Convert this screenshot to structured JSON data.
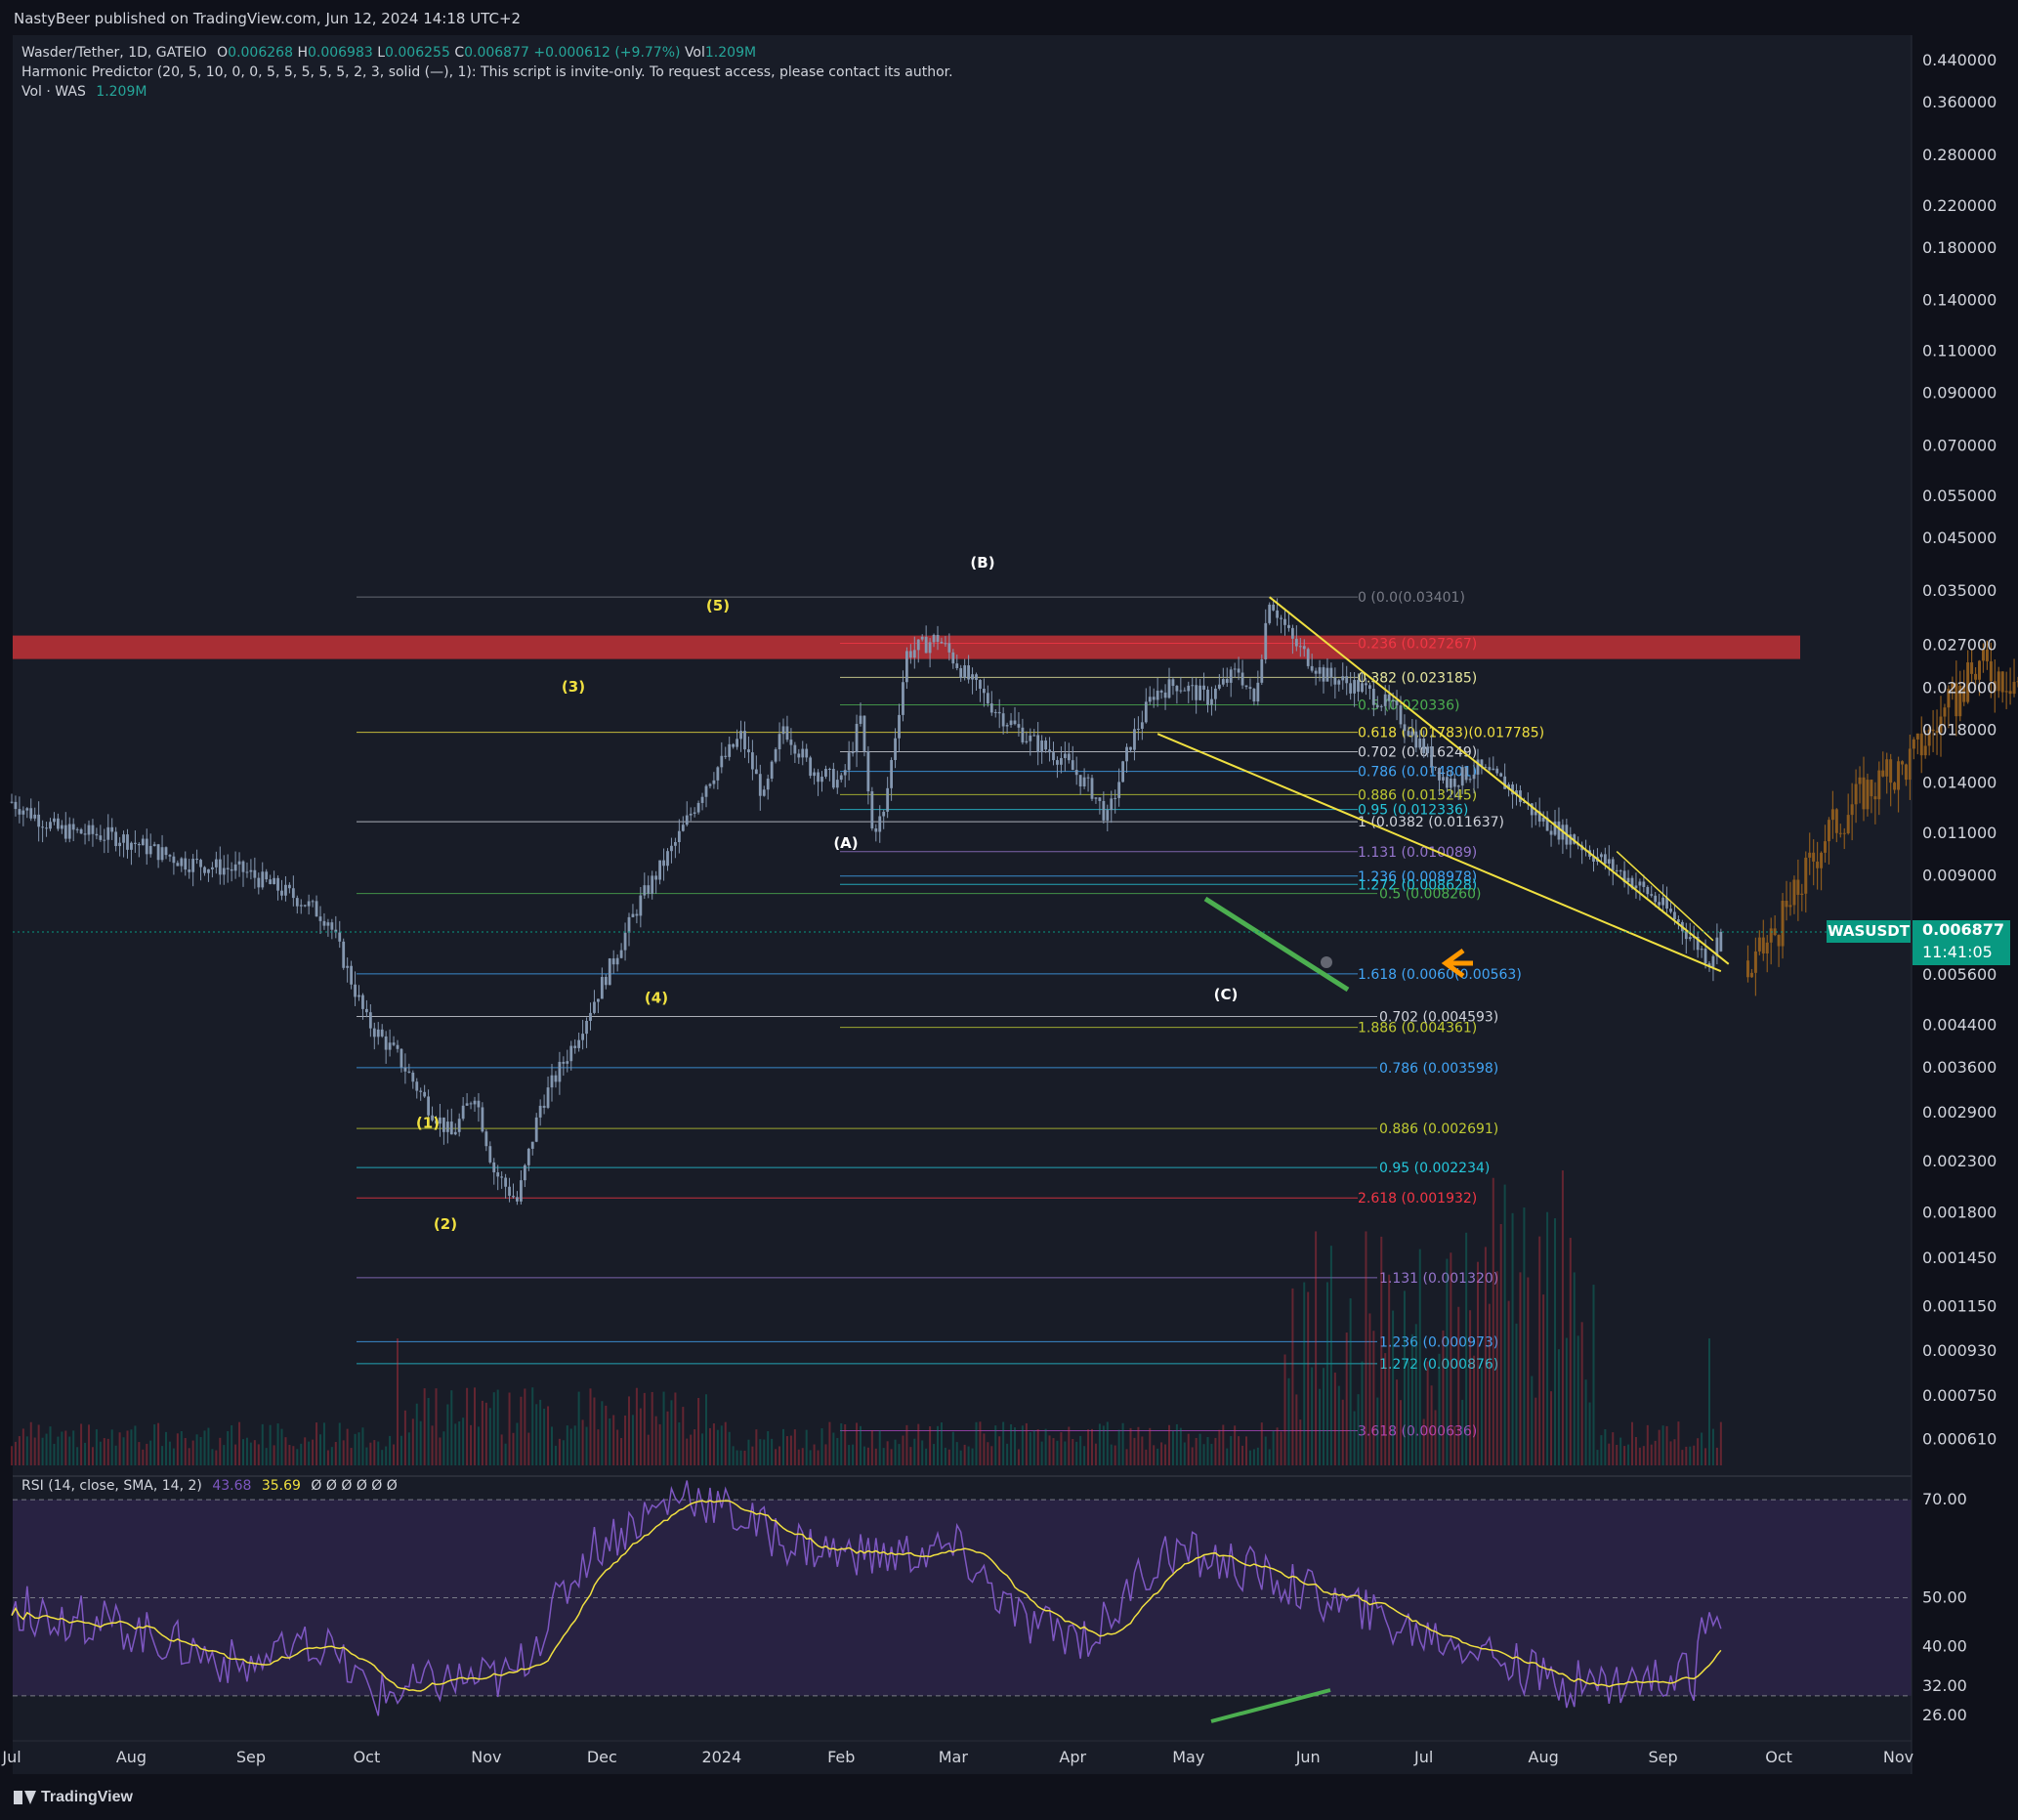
{
  "header": {
    "published": "NastyBeer published on TradingView.com, Jun 12, 2024 14:18 UTC+2"
  },
  "legend": {
    "symbol": "Wasder/Tether, 1D, GATEIO",
    "o_label": "O",
    "o": "0.006268",
    "h_label": "H",
    "h": "0.006983",
    "l_label": "L",
    "l": "0.006255",
    "c_label": "C",
    "c": "0.006877",
    "change": "+0.000612 (+9.77%)",
    "vol_label": "Vol",
    "vol": "1.209M",
    "indicator": "Harmonic Predictor (20, 5, 10, 0, 0, 5, 5, 5, 5, 5, 2, 3, solid (—), 1): This script is invite-only. To request access, please contact its author.",
    "vol_line_label": "Vol · WAS",
    "vol_line_value": "1.209M"
  },
  "rsi_legend": {
    "label": "RSI (14, close, SMA, 14, 2)",
    "rsi": "43.68",
    "sma": "35.69",
    "extra": "Ø Ø Ø Ø Ø Ø"
  },
  "symbol_tag": "WASUSDT",
  "price_tag": {
    "price": "0.006877",
    "countdown": "11:41:05"
  },
  "footer": {
    "brand": "TradingView"
  },
  "colors": {
    "up": "#089981",
    "down": "#f23645",
    "bg": "#181c27",
    "candle": "#8497b0",
    "projection": "#8b5a1e",
    "resistance": "#d9343a",
    "wedge": "#f0e040",
    "green": "#4caf50",
    "rsi": "#7e57c2",
    "arrow": "#ff9800"
  },
  "chart_data": {
    "type": "candlestick",
    "log_scale": true,
    "price_axis_labels": [
      "0.440000",
      "0.360000",
      "0.280000",
      "0.220000",
      "0.180000",
      "0.140000",
      "0.110000",
      "0.090000",
      "0.070000",
      "0.055000",
      "0.045000",
      "0.035000",
      "0.027000",
      "0.022000",
      "0.018000",
      "0.014000",
      "0.011000",
      "0.009000",
      "0.005600",
      "0.004400",
      "0.003600",
      "0.002900",
      "0.002300",
      "0.001800",
      "0.001450",
      "0.001150",
      "0.000930",
      "0.000750",
      "0.000610"
    ],
    "time_axis_labels": [
      "Jul",
      "Aug",
      "Sep",
      "Oct",
      "Nov",
      "Dec",
      "2024",
      "Feb",
      "Mar",
      "Apr",
      "May",
      "Jun",
      "Jul",
      "Aug",
      "Sep",
      "Oct",
      "Nov"
    ],
    "rsi_axis_labels": [
      "70.00",
      "50.00",
      "40.00",
      "32.00",
      "26.00"
    ],
    "wave_labels": [
      "(1)",
      "(2)",
      "(3)",
      "(4)",
      "(5)",
      "(A)",
      "(B)",
      "(C)"
    ],
    "fib_labels": [
      {
        "text": "0 (0.0(0.03401)",
        "color": "#787b86"
      },
      {
        "text": "0.236 (0.027267)",
        "color": "#f23645"
      },
      {
        "text": "0.382 (0.023185)",
        "color": "#e8e8a0"
      },
      {
        "text": "0.5 (0.020336)",
        "color": "#4caf50"
      },
      {
        "text": "0.618 (0.01783)(0.017785)",
        "color": "#f0e040"
      },
      {
        "text": "0.702 (0.016249)",
        "color": "#d1d4dc"
      },
      {
        "text": "0.786 (0.014801)",
        "color": "#42a5f5"
      },
      {
        "text": "0.886 (0.013245)",
        "color": "#c0ca33"
      },
      {
        "text": "0.95 (0.012336)",
        "color": "#26c6da"
      },
      {
        "text": "1 (0.0382 (0.011637)",
        "color": "#d1d4dc"
      },
      {
        "text": "1.131 (0.010089)",
        "color": "#9575cd"
      },
      {
        "text": "1.236 (0.008978)",
        "color": "#42a5f5"
      },
      {
        "text": "1.272 (0.008628)",
        "color": "#26c6da"
      },
      {
        "text": "0.5 (0.008260)",
        "color": "#4caf50"
      },
      {
        "text": "1.618 (0.0060(0.00563)",
        "color": "#42a5f5"
      },
      {
        "text": "0.702 (0.004593)",
        "color": "#d1d4dc"
      },
      {
        "text": "1.886 (0.004361)",
        "color": "#c0ca33"
      },
      {
        "text": "0.786 (0.003598)",
        "color": "#42a5f5"
      },
      {
        "text": "0.886 (0.002691)",
        "color": "#c0ca33"
      },
      {
        "text": "0.95 (0.002234)",
        "color": "#26c6da"
      },
      {
        "text": "2.618 (0.001932)",
        "color": "#f23645"
      },
      {
        "text": "1.131 (0.001320)",
        "color": "#9575cd"
      },
      {
        "text": "1.236 (0.000973)",
        "color": "#42a5f5"
      },
      {
        "text": "1.272 (0.000876)",
        "color": "#26c6da"
      },
      {
        "text": "3.618 (0.000636)",
        "color": "#ab47bc"
      }
    ],
    "wave_points": [
      {
        "label": "(1)",
        "price": 0.0026
      },
      {
        "label": "(2)",
        "price": 0.0019
      },
      {
        "label": "(3)",
        "price": 0.019
      },
      {
        "label": "(4)",
        "price": 0.0058
      },
      {
        "label": "(5)",
        "price": 0.028
      },
      {
        "label": "(A)",
        "price": 0.0117
      },
      {
        "label": "(B)",
        "price": 0.034
      },
      {
        "label": "(C)",
        "price": 0.006
      }
    ],
    "last": {
      "open": 0.006268,
      "high": 0.006983,
      "low": 0.006255,
      "close": 0.006877
    },
    "resistance_zone": [
      0.0253,
      0.0283
    ]
  }
}
